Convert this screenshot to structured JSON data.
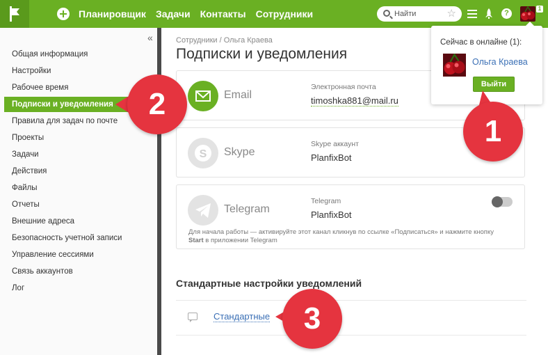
{
  "topbar": {
    "nav": [
      "Планировщик",
      "Задачи",
      "Контакты",
      "Сотрудники"
    ],
    "search_placeholder": "Найти",
    "help_label": "?",
    "badge_count": "1"
  },
  "sidebar": {
    "collapse_label": "«",
    "items": [
      "Общая информация",
      "Настройки",
      "Рабочее время",
      "Подписки и уведомления",
      "Правила для задач по почте",
      "Проекты",
      "Задачи",
      "Действия",
      "Файлы",
      "Отчеты",
      "Внешние адреса",
      "Безопасность учетной записи",
      "Управление сессиями",
      "Связь аккаунтов",
      "Лог"
    ],
    "active_index": 3
  },
  "main": {
    "breadcrumb": "Сотрудники / Ольга Краева",
    "title": "Подписки и уведомления",
    "channels": {
      "email": {
        "name": "Email",
        "label": "Электронная почта",
        "value": "timoshka881@mail.ru"
      },
      "skype": {
        "name": "Skype",
        "label": "Skype аккаунт",
        "value": "PlanfixBot"
      },
      "telegram": {
        "name": "Telegram",
        "label": "Telegram",
        "value": "PlanfixBot",
        "note_part1": "Для начала работы — активируйте этот канал кликнув по ссылке «Подписаться» и нажмите кнопку",
        "note_bold": "Start",
        "note_part2": " в приложении Telegram",
        "enabled": false
      }
    },
    "standard_section_title": "Стандартные настройки уведомлений",
    "standard_link": "Стандартные"
  },
  "popup": {
    "online_text": "Сейчас в онлайне (1):",
    "user_name": "Ольга Краева",
    "logout_label": "Выйти"
  },
  "callouts": [
    "1",
    "2",
    "3"
  ],
  "colors": {
    "brand_green": "#6ab023",
    "callout_red": "#e5343f",
    "link_blue": "#3a6fb5"
  }
}
